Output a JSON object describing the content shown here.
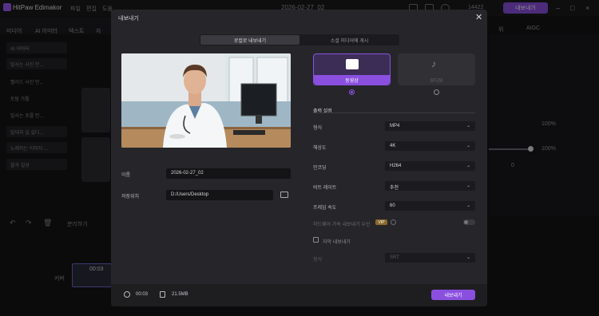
{
  "app": {
    "name": "HitPaw Edimakor",
    "menu": [
      "파일",
      "편집",
      "도움"
    ],
    "date_title": "2026-02-27_02",
    "credits": "14422",
    "export_label": "내보내기"
  },
  "left_tabs": [
    "미디어",
    "AI 어미터",
    "텍스트",
    "자"
  ],
  "side_items": [
    "AI 어마터",
    "발사는 사진 안...",
    "빨리드 사진 안...",
    "토탐 가톨",
    "발사는 포를 안...",
    "발대지 일 실디...",
    "노래하는 이미지 ...",
    "블과 설성"
  ],
  "dialog": {
    "title": "내보내기",
    "tabs": [
      "로컬로 내보내기",
      "소셜 미디어에 게시"
    ],
    "name_label": "이름",
    "name_value": "2026-02-27_02",
    "path_label": "저장위치",
    "path_value": "D:/Users/Desktop",
    "cards": [
      {
        "label": "동영상",
        "selected": true
      },
      {
        "label": "오디오",
        "selected": false
      }
    ],
    "section_title": "출력 설정",
    "settings": [
      {
        "label": "형식",
        "value": "MP4"
      },
      {
        "label": "해상도",
        "value": "4K"
      },
      {
        "label": "인코딩",
        "value": "H264"
      },
      {
        "label": "비트 레이트",
        "value": "추천"
      },
      {
        "label": "프레임 속도",
        "value": "60"
      }
    ],
    "hw_label": "하드웨어 가속 내보내기 우선",
    "vip_badge": "VIP",
    "subtitle_export_label": "자막 내보내기",
    "subtitle_format_label": "형식",
    "subtitle_format_value": "SRT",
    "duration": "00:03",
    "file_size": "21.5MB",
    "export_button": "내보내기"
  },
  "right_panel": {
    "tabs": [
      "위",
      "AIGC"
    ],
    "percent1": "100%",
    "percent2": "100%",
    "coord": "0"
  },
  "timeline": {
    "split_label": "분리하기",
    "track_label": "커버",
    "clip_duration": "00:03"
  },
  "colors": {
    "accent": "#8b4fe0",
    "dialog_bg": "#26262a"
  }
}
